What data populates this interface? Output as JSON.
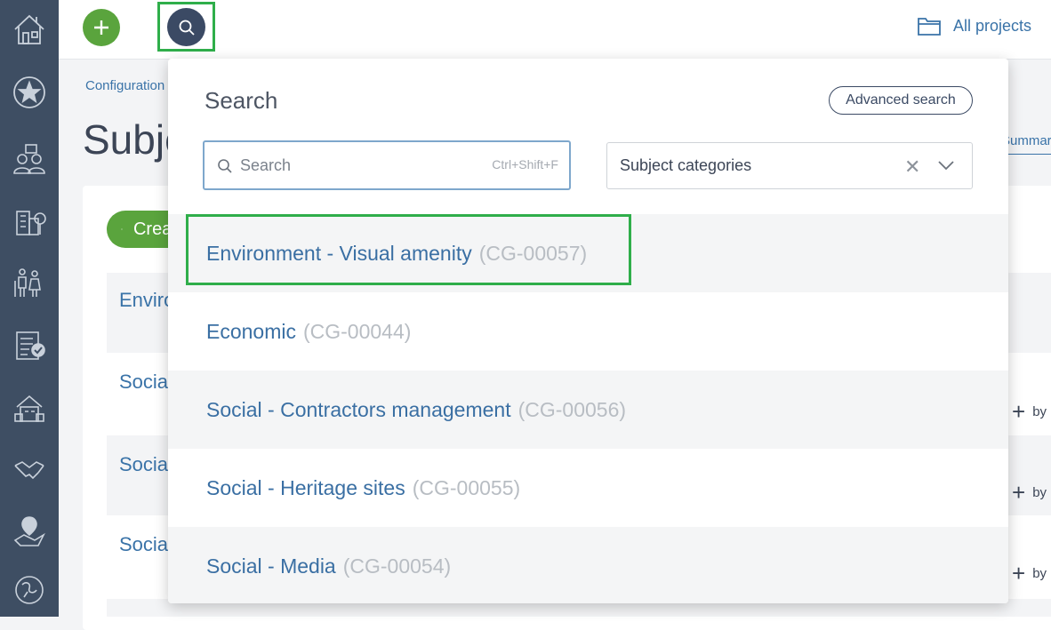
{
  "topbar": {
    "all_projects_label": "All projects"
  },
  "page": {
    "breadcrumb": "Configuration",
    "title": "Subjects",
    "summary_tab": "Summary",
    "create_button": "Create",
    "background_rows": [
      {
        "label": "Environment - Visual amenity",
        "by": ""
      },
      {
        "label": "Social - Contractors management",
        "by": "by"
      },
      {
        "label": "Social - Heritage sites",
        "by": "by"
      },
      {
        "label": "Social - Media",
        "by": "by"
      }
    ]
  },
  "search_panel": {
    "title": "Search",
    "advanced_search_label": "Advanced search",
    "search_placeholder": "Search",
    "shortcut_hint": "Ctrl+Shift+F",
    "category_filter_value": "Subject categories",
    "results": [
      {
        "name": "Environment - Visual amenity",
        "code": "(CG-00057)"
      },
      {
        "name": "Economic",
        "code": "(CG-00044)"
      },
      {
        "name": "Social - Contractors management",
        "code": "(CG-00056)"
      },
      {
        "name": "Social - Heritage sites",
        "code": "(CG-00055)"
      },
      {
        "name": "Social - Media",
        "code": "(CG-00054)"
      }
    ]
  },
  "colors": {
    "sidebar": "#3e4e63",
    "accent_green": "#5aa43d",
    "link_blue": "#3a73a8",
    "highlight_green": "#2fae4a"
  },
  "icons": [
    "house-icon",
    "star-icon",
    "stakeholders-icon",
    "buildings-icon",
    "community-icon",
    "checklist-icon",
    "property-icon",
    "handshake-icon",
    "map-pin-icon",
    "environment-icon",
    "plus-icon",
    "search-icon",
    "folder-icon",
    "close-icon",
    "chevron-down-icon"
  ]
}
